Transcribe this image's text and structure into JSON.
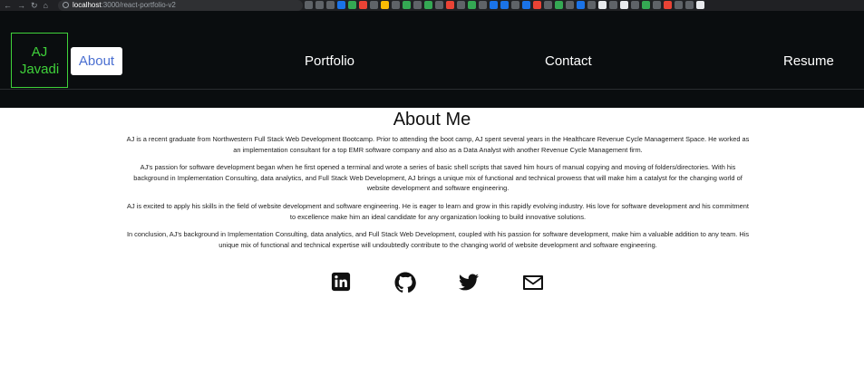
{
  "browser": {
    "url_host": "localhost",
    "url_path": ":3000/react-portfolio-v2"
  },
  "nav": {
    "logo_line1": "AJ",
    "logo_line2": "Javadi",
    "about": "About",
    "portfolio": "Portfolio",
    "contact": "Contact",
    "resume": "Resume"
  },
  "about": {
    "title": "About Me",
    "paragraphs": [
      "AJ is a recent graduate from Northwestern Full Stack Web Development Bootcamp. Prior to attending the boot camp, AJ spent several years in the Healthcare Revenue Cycle Management Space. He worked as an implementation consultant for a top EMR software company and also as a Data Analyst with another Revenue Cycle Management firm.",
      "AJ's passion for software development began when he first opened a terminal and wrote a series of basic shell scripts that saved him hours of manual copying and moving of folders/directories. With his background in Implementation Consulting, data analytics, and Full Stack Web Development, AJ brings a unique mix of functional and technical prowess that will make him a catalyst for the changing world of website development and software engineering.",
      "AJ is excited to apply his skills in the field of website development and software engineering. He is eager to learn and grow in this rapidly evolving industry. His love for software development and his commitment to excellence make him an ideal candidate for any organization looking to build innovative solutions.",
      "In conclusion, AJ's background in Implementation Consulting, data analytics, and Full Stack Web Development, coupled with his passion for software development, make him a valuable addition to any team. His unique mix of functional and technical expertise will undoubtedly contribute to the changing world of website development and software engineering."
    ]
  },
  "social": {
    "icons": [
      "linkedin-icon",
      "github-icon",
      "twitter-icon",
      "email-icon"
    ]
  },
  "colors": {
    "navbar_bg": "#0a0d0f",
    "logo_green": "#3fd13a",
    "active_link": "#4a6fd1"
  }
}
